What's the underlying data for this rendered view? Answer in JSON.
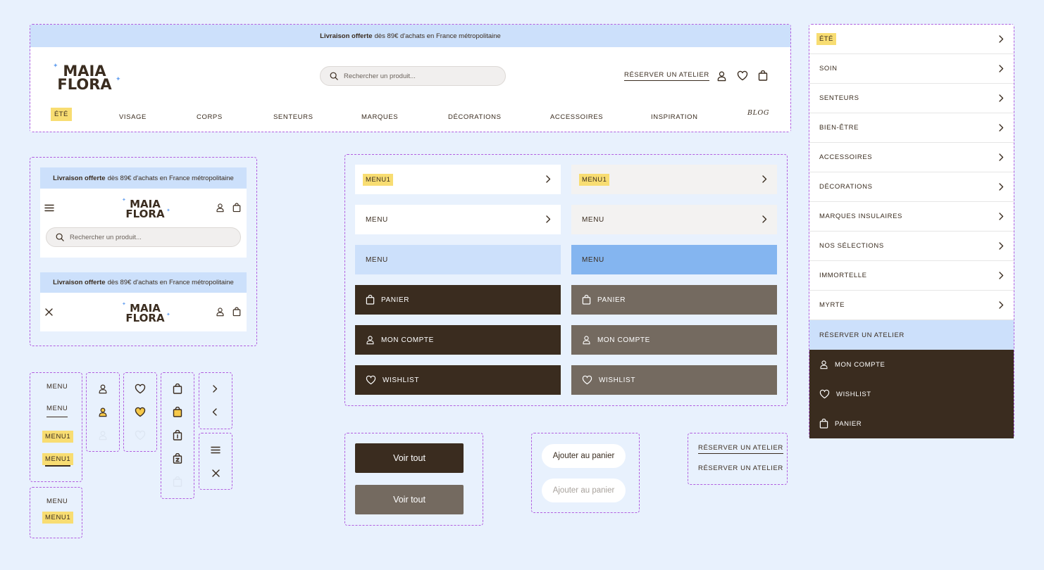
{
  "announce": {
    "bold": "Livraison offerte",
    "rest": "dès 89€ d'achats en France métropolitaine"
  },
  "logo": {
    "line1": "MAIA",
    "line2": "FLORA"
  },
  "search": {
    "placeholder": "Rechercher un produit..."
  },
  "header": {
    "atelier_link": "RÉSERVER UN ATELIER"
  },
  "nav": {
    "items": [
      "ÉTÉ",
      "VISAGE",
      "CORPS",
      "SENTEURS",
      "MARQUES",
      "DÉCORATIONS",
      "ACCESSOIRES",
      "INSPIRATION",
      "BLOG"
    ]
  },
  "icons": {
    "user": "user-icon",
    "heart": "heart-icon",
    "bag": "bag-icon",
    "search": "search-icon",
    "chevron": "chevron-right-icon",
    "burger": "burger-menu-icon",
    "close": "close-icon"
  },
  "states": {
    "menu": "MENU",
    "menu1": "MENU1"
  },
  "rows": {
    "panier": "PANIER",
    "compte": "MON COMPTE",
    "wishlist": "WISHLIST"
  },
  "buttons": {
    "voir_tout": "Voir tout",
    "ajouter": "Ajouter au panier",
    "atelier": "RÉSERVER UN ATELIER"
  },
  "sidebar": {
    "items": [
      "ÉTÉ",
      "SOIN",
      "SENTEURS",
      "BIEN-ÊTRE",
      "ACCESSOIRES",
      "DÉCORATIONS",
      "MARQUES INSULAIRES",
      "NOS SÉLECTIONS",
      "IMMORTELLE",
      "MYRTE"
    ],
    "atelier": "RÉSERVER UN ATELIER",
    "compte": "MON COMPTE",
    "wishlist": "WISHLIST",
    "panier": "PANIER"
  },
  "colors": {
    "background": "#e8f1fd",
    "announce": "#cce0fb",
    "brand_dark": "#3a2c1f",
    "brand_grey": "#746a60",
    "accent_yellow": "#f8dd72",
    "active_blue": "#84b5f0",
    "dash": "#b15ee0"
  }
}
